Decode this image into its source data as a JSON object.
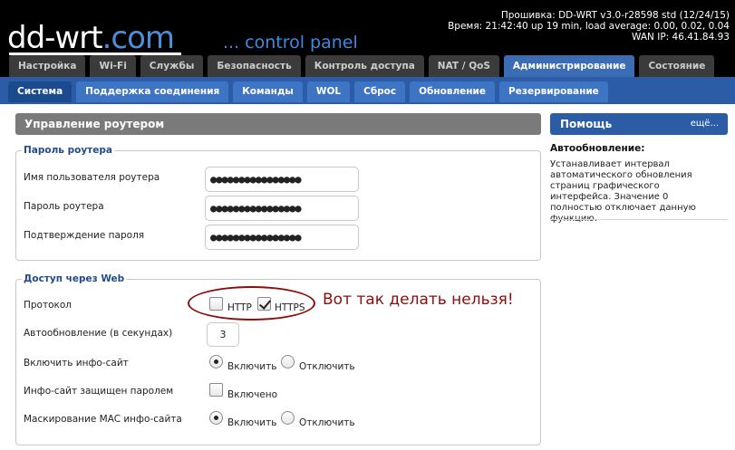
{
  "header": {
    "logo_main": "dd-wrt",
    "logo_dot": ".",
    "logo_com": "com",
    "tagline": "... control panel",
    "firmware": "Прошивка: DD-WRT v3.0-r28598 std (12/24/15)",
    "time": "Время: 21:42:40 up 19 min, load average: 0.00, 0.02, 0.04",
    "wan_ip": "WAN IP: 46.41.84.93"
  },
  "main_tabs": [
    {
      "label": "Настройка",
      "active": false
    },
    {
      "label": "Wi-Fi",
      "active": false
    },
    {
      "label": "Службы",
      "active": false
    },
    {
      "label": "Безопасность",
      "active": false
    },
    {
      "label": "Контроль доступа",
      "active": false
    },
    {
      "label": "NAT / QoS",
      "active": false
    },
    {
      "label": "Администрирование",
      "active": true
    },
    {
      "label": "Состояние",
      "active": false
    }
  ],
  "sub_tabs": [
    {
      "label": "Система",
      "active": true
    },
    {
      "label": "Поддержка соединения",
      "active": false
    },
    {
      "label": "Команды",
      "active": false
    },
    {
      "label": "WOL",
      "active": false
    },
    {
      "label": "Сброс",
      "active": false
    },
    {
      "label": "Обновление",
      "active": false
    },
    {
      "label": "Резервирование",
      "active": false
    }
  ],
  "section_title": "Управление роутером",
  "password_group": {
    "legend": "Пароль роутера",
    "username_label": "Имя пользователя роутера",
    "username_value": "●●●●●●●●●●●●●●●●",
    "password_label": "Пароль роутера",
    "password_value": "●●●●●●●●●●●●●●●●",
    "confirm_label": "Подтверждение пароля",
    "confirm_value": "●●●●●●●●●●●●●●●●"
  },
  "web_access": {
    "legend": "Доступ через Web",
    "protocol_label": "Протокол",
    "http_label": "HTTP",
    "http_checked": false,
    "https_label": "HTTPS",
    "https_checked": true,
    "refresh_label": "Автообновление (в секундах)",
    "refresh_value": "3",
    "info_site_label": "Включить инфо-сайт",
    "info_site_on": "Включить",
    "info_site_off": "Отключить",
    "info_site_enabled": true,
    "info_pw_label": "Инфо-сайт защищен паролем",
    "info_pw_option": "Включено",
    "info_pw_checked": false,
    "mac_mask_label": "Маскирование MAC инфо-сайта",
    "mac_mask_on": "Включить",
    "mac_mask_off": "Отключить",
    "mac_mask_enabled": true
  },
  "annotation": "Вот так делать нельзя!",
  "help": {
    "title": "Помощь",
    "more": "ещё...",
    "subtitle": "Автообновление:",
    "text": "Устанавливает интервал автоматического обновления страниц графического интерфейса. Значение 0 полностью отключает данную функцию."
  },
  "colors": {
    "header_bg": "#000000",
    "accent_blue": "#2c5ca5",
    "active_tab": "#3a6db3",
    "annotation_red": "#8b0d0d"
  }
}
